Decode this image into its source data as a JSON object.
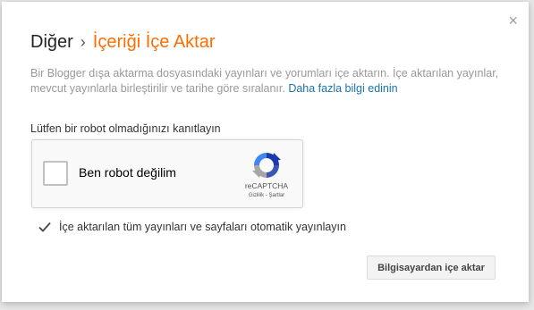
{
  "dialog": {
    "close_label": "×",
    "breadcrumb_parent": "Diğer",
    "breadcrumb_separator": "›",
    "breadcrumb_current": "İçeriği İçe Aktar",
    "description": "Bir Blogger dışa aktarma dosyasındaki yayınları ve yorumları içe aktarın. İçe aktarılan yayınlar, mevcut yayınlarla birleştirilir ve tarihe göre sıralanır.",
    "learn_more_link": "Daha fazla bilgi edinin",
    "robot_prompt": "Lütfen bir robot olmadığınızı kanıtlayın",
    "recaptcha": {
      "checkbox_label": "Ben robot değilim",
      "brand": "reCAPTCHA",
      "links": "Gizlilik - Şartlar"
    },
    "autopublish_label": "İçe aktarılan tüm yayınları ve sayfaları otomatik yayınlayın",
    "autopublish_checked": true,
    "import_button": "Bilgisayardan içe aktar"
  },
  "colors": {
    "accent": "#ff6d00",
    "link": "#1a73a8"
  }
}
